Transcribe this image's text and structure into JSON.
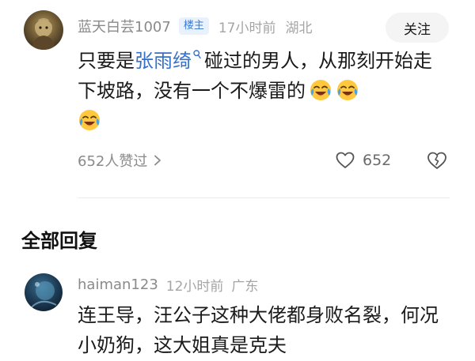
{
  "main_comment": {
    "avatar_icon": "user-avatar-icon",
    "username": "蓝天白芸1007",
    "op_badge": "楼主",
    "time": "17小时前",
    "location": "湖北",
    "follow_label": "关注",
    "body_prefix": "只要是",
    "mention": "张雨绮",
    "body_line": "碰过的男人，从那刻开始走下坡路，没有一个不爆雷的",
    "emoji_name": "tears-of-joy-emoji",
    "emoji_count": 3,
    "likes_text": "652人赞过",
    "like_count": "652"
  },
  "replies_section": {
    "title": "全部回复"
  },
  "reply": {
    "avatar_icon": "user-avatar-icon",
    "username": "haiman123",
    "time": "12小时前",
    "location": "广东",
    "body": "连王导，汪公子这种大佬都身败名裂，何况小奶狗，这大姐真是克夫"
  },
  "colors": {
    "mention": "#3670c9",
    "badge_text": "#3a7bd5",
    "badge_bg": "#e9f1fc",
    "meta": "#a5a5a5",
    "follow_bg": "#f4f4f4"
  }
}
